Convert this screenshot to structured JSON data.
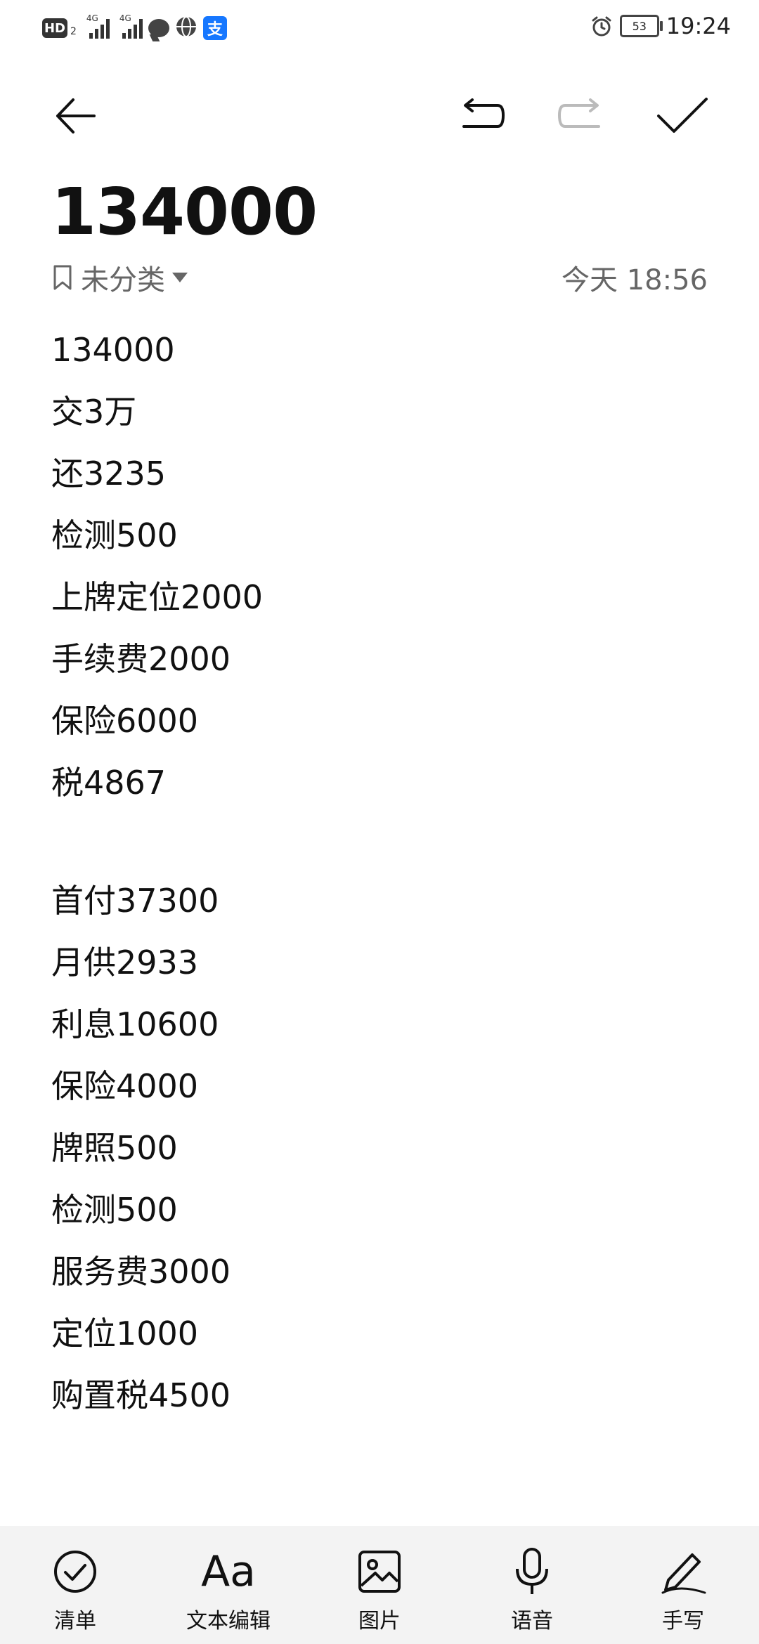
{
  "status_bar": {
    "hd_label": "HD",
    "hd_sub": "2",
    "signal1_tag": "4G",
    "signal2_tag": "4G",
    "battery": "53",
    "time": "19:24",
    "alipay_glyph": "支",
    "icons": [
      "chat-icon",
      "globe-icon",
      "alipay-icon",
      "alarm-icon",
      "battery-icon"
    ]
  },
  "toolbar": {
    "icons": [
      "back-arrow-icon",
      "undo-icon",
      "redo-icon",
      "check-icon"
    ]
  },
  "note": {
    "title": "134000",
    "category": "未分类",
    "date": "今天 18:56",
    "lines": [
      "134000",
      "交3万",
      "还3235",
      "检测500",
      "上牌定位2000",
      "手续费2000",
      "保险6000",
      "税4867",
      "",
      "首付37300",
      "月供2933",
      "利息10600",
      "保险4000",
      "牌照500",
      "检测500",
      "服务费3000",
      "定位1000",
      "购置税4500"
    ]
  },
  "bottom_bar": {
    "checklist": "清单",
    "text_edit_glyph": "Aa",
    "text_edit": "文本编辑",
    "image": "图片",
    "voice": "语音",
    "handwrite": "手写"
  },
  "colors": {
    "text": "#111111",
    "muted": "#666666",
    "bottom_bg": "#f3f3f3",
    "disabled": "#bbbbbb",
    "alipay": "#1677ff"
  }
}
